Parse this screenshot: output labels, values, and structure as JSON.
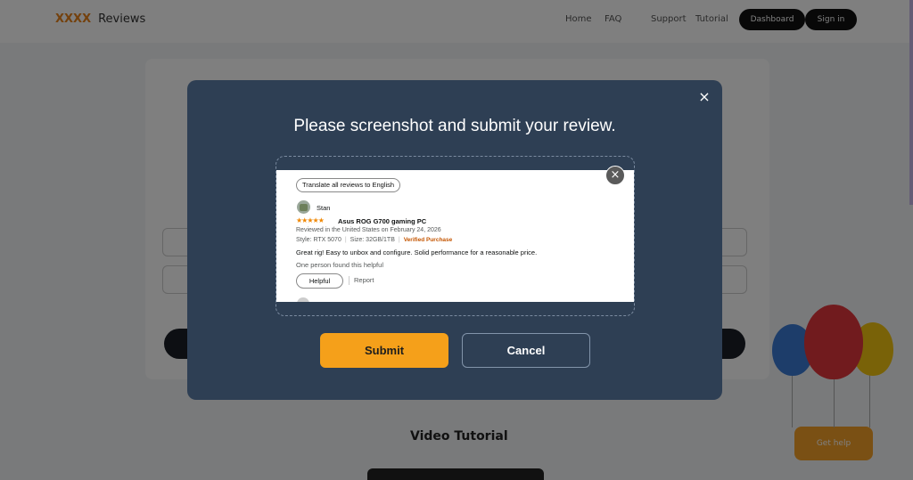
{
  "background": {
    "logo": "XXXX",
    "logo_sub": "Reviews",
    "nav": [
      "Home",
      "FAQ",
      "Support",
      "Tutorial"
    ],
    "nav_buttons": [
      "Dashboard",
      "Sign in"
    ],
    "section_title": "Video Tutorial",
    "floating_button": "Get help"
  },
  "modal": {
    "title": "Please screenshot and submit your review.",
    "submit_label": "Submit",
    "cancel_label": "Cancel",
    "close_icon": "×",
    "screenshot_close_icon": "×"
  },
  "review": {
    "translate_label": "Translate all reviews to English",
    "reviewer_name": "Stan",
    "stars": "★★★★★",
    "rating": 5,
    "title": "Asus ROG G700 gaming PC",
    "date_line": "Reviewed in the United States on February 24, 2026",
    "style": "Style: RTX 5070",
    "size": "Size: 32GB/1TB",
    "verified": "Verified Purchase",
    "body": "Great rig! Easy to unbox and configure. Solid performance for a reasonable price.",
    "helpful_count": "One person found this helpful",
    "helpful_label": "Helpful",
    "report_label": "Report"
  },
  "colors": {
    "modal_bg": "#2e3f54",
    "submit_bg": "#f5a01a",
    "star_color": "#f08804",
    "verified_color": "#c45500"
  }
}
